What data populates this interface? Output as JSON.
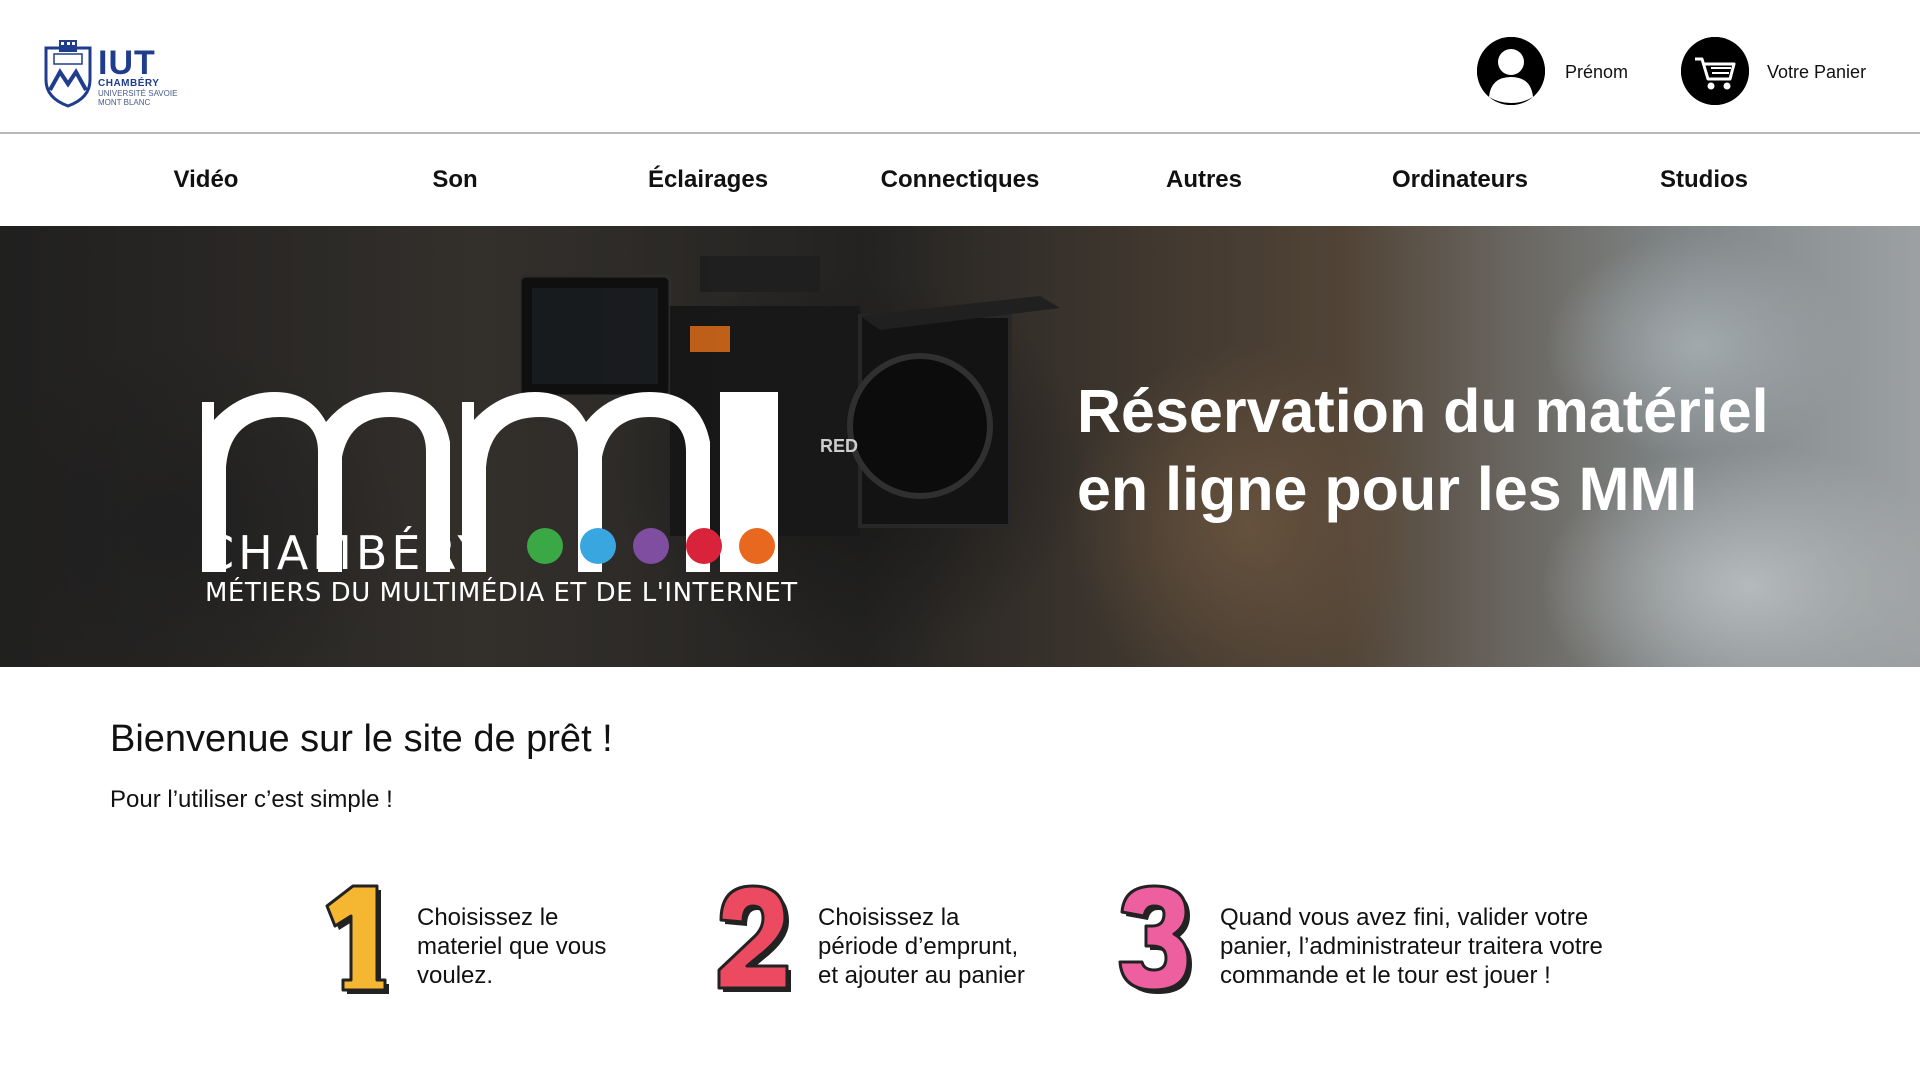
{
  "header": {
    "logo": {
      "name": "IUT",
      "city": "CHAMBÉRY",
      "university_line1": "UNIVERSITÉ SAVOIE",
      "university_line2": "MONT BLANC",
      "brand_color": "#1f3d8c"
    },
    "profile_icon": "user-avatar-icon",
    "profile_label": "Prénom",
    "cart_icon": "shopping-cart-icon",
    "cart_label": "Votre Panier"
  },
  "nav": {
    "items": [
      {
        "label": "Vidéo"
      },
      {
        "label": "Son"
      },
      {
        "label": "Éclairages"
      },
      {
        "label": "Connectiques"
      },
      {
        "label": "Autres"
      },
      {
        "label": "Ordinateurs"
      },
      {
        "label": "Studios"
      }
    ]
  },
  "hero": {
    "brand": "mmi",
    "city": "CHAMBÉRY",
    "tagline": "MÉTIERS DU MULTIMÉDIA ET DE L'INTERNET",
    "dot_colors": [
      "#3aa845",
      "#3aa6e0",
      "#7f4ea0",
      "#d8233a",
      "#e8681f"
    ],
    "title_line1": "Réservation du matériel",
    "title_line2": "en ligne pour les MMI"
  },
  "welcome": {
    "title": "Bienvenue sur le site de prêt !",
    "subtitle": "Pour l’utiliser c’est simple !"
  },
  "steps": [
    {
      "number": "1",
      "color": "#f5b731",
      "lines": [
        "Choisissez le",
        "materiel que vous",
        "voulez."
      ]
    },
    {
      "number": "2",
      "color": "#ec4a61",
      "lines": [
        "Choisissez la",
        "période d’emprunt,",
        "et ajouter au panier"
      ]
    },
    {
      "number": "3",
      "color": "#ee5fa0",
      "lines": [
        "Quand vous avez fini, valider votre",
        "panier, l’administrateur traitera votre",
        "commande et le tour est jouer !"
      ]
    }
  ]
}
